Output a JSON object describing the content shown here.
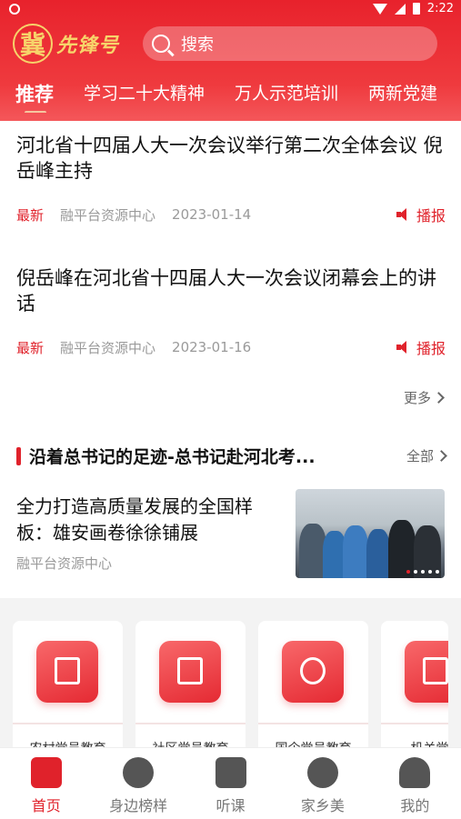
{
  "header": {
    "status_time": "2:22",
    "logo_char": "冀",
    "logo_text": "先锋号",
    "search_placeholder": "搜索"
  },
  "tabs": [
    {
      "label": "推荐"
    },
    {
      "label": "学习二十大精神"
    },
    {
      "label": "万人示范培训"
    },
    {
      "label": "两新党建"
    }
  ],
  "news": [
    {
      "title": "河北省十四届人大一次会议举行第二次全体会议 倪岳峰主持",
      "tag": "最新",
      "source": "融平台资源中心",
      "date": "2023-01-14",
      "play": "播报"
    },
    {
      "title": "倪岳峰在河北省十四届人大一次会议闭幕会上的讲话",
      "tag": "最新",
      "source": "融平台资源中心",
      "date": "2023-01-16",
      "play": "播报"
    }
  ],
  "more_label": "更多",
  "section": {
    "title": "沿着总书记的足迹-总书记赴河北考...",
    "all_label": "全部"
  },
  "feature": {
    "title": "全力打造高质量发展的全国样板：雄安画卷徐徐铺展",
    "source": "融平台资源中心"
  },
  "cards": [
    {
      "label": "农村党员教育",
      "icon": "building-icon"
    },
    {
      "label": "社区党员教育",
      "icon": "office-icon"
    },
    {
      "label": "国企党员教育",
      "icon": "star-badge-icon"
    },
    {
      "label": "机关党员",
      "icon": "bank-icon"
    }
  ],
  "bottom_nav": [
    {
      "label": "首页",
      "icon": "home-book-icon"
    },
    {
      "label": "身边榜样",
      "icon": "medal-icon"
    },
    {
      "label": "听课",
      "icon": "lecture-icon"
    },
    {
      "label": "家乡美",
      "icon": "landscape-icon"
    },
    {
      "label": "我的",
      "icon": "person-icon"
    }
  ],
  "colors": {
    "brand_red": "#e0222b",
    "logo_gold": "#f7d36a"
  }
}
